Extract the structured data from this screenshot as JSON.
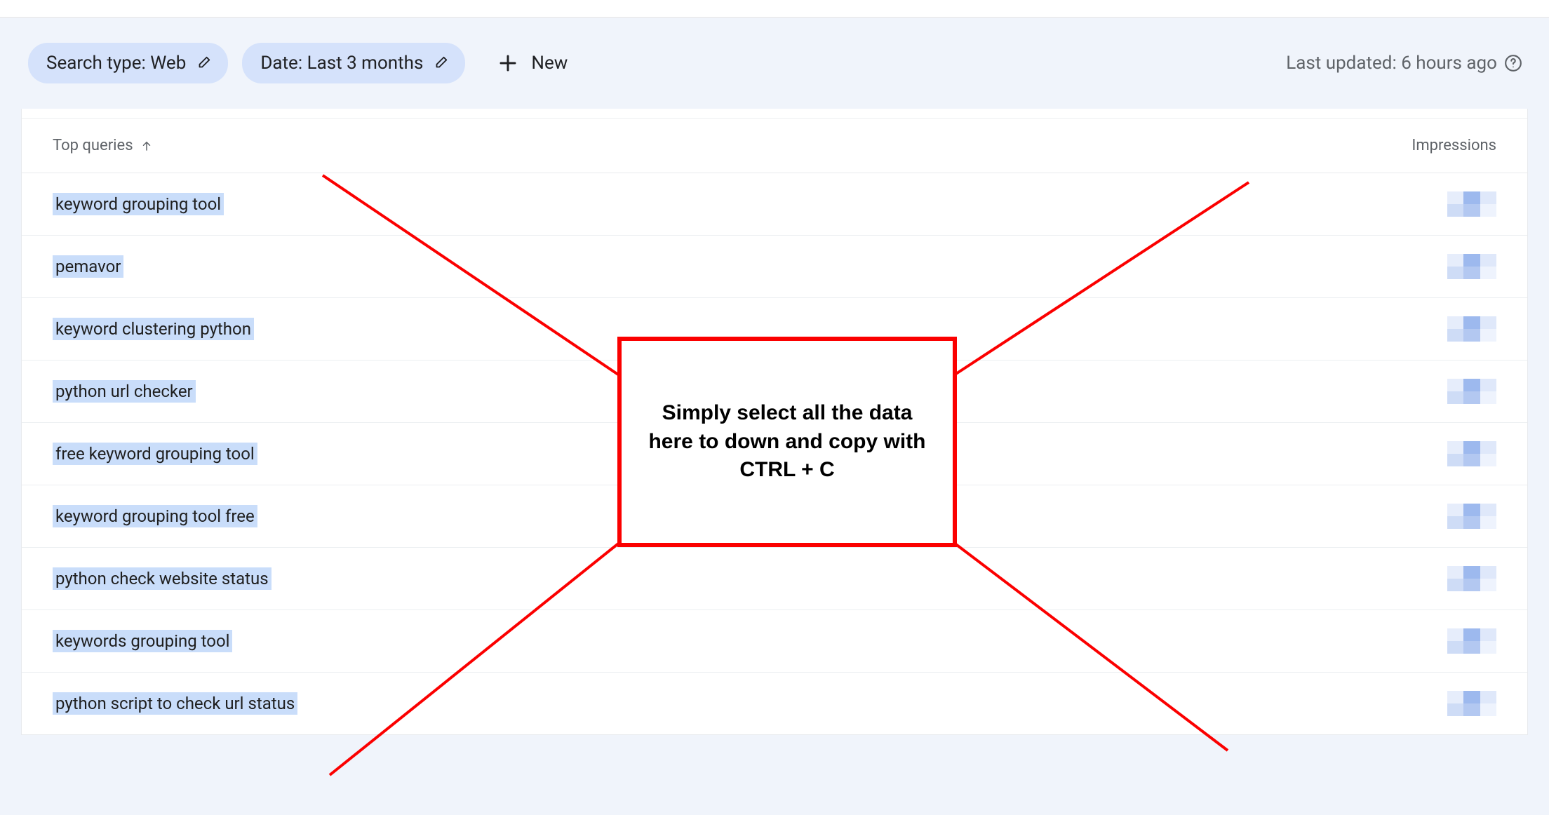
{
  "filters": {
    "search_type": {
      "label": "Search type: Web"
    },
    "date": {
      "label": "Date: Last 3 months"
    },
    "new_label": "New"
  },
  "last_updated": "Last updated: 6 hours ago",
  "table": {
    "header": {
      "queries": "Top queries",
      "impressions": "Impressions"
    },
    "rows": [
      {
        "query": "keyword grouping tool"
      },
      {
        "query": "pemavor"
      },
      {
        "query": "keyword clustering python"
      },
      {
        "query": "python url checker"
      },
      {
        "query": "free keyword grouping tool"
      },
      {
        "query": "keyword grouping tool free"
      },
      {
        "query": "python check website status"
      },
      {
        "query": "keywords grouping tool"
      },
      {
        "query": "python script to check url status"
      }
    ]
  },
  "annotation": {
    "text": "Simply select all the data here to down and copy with CTRL + C"
  }
}
